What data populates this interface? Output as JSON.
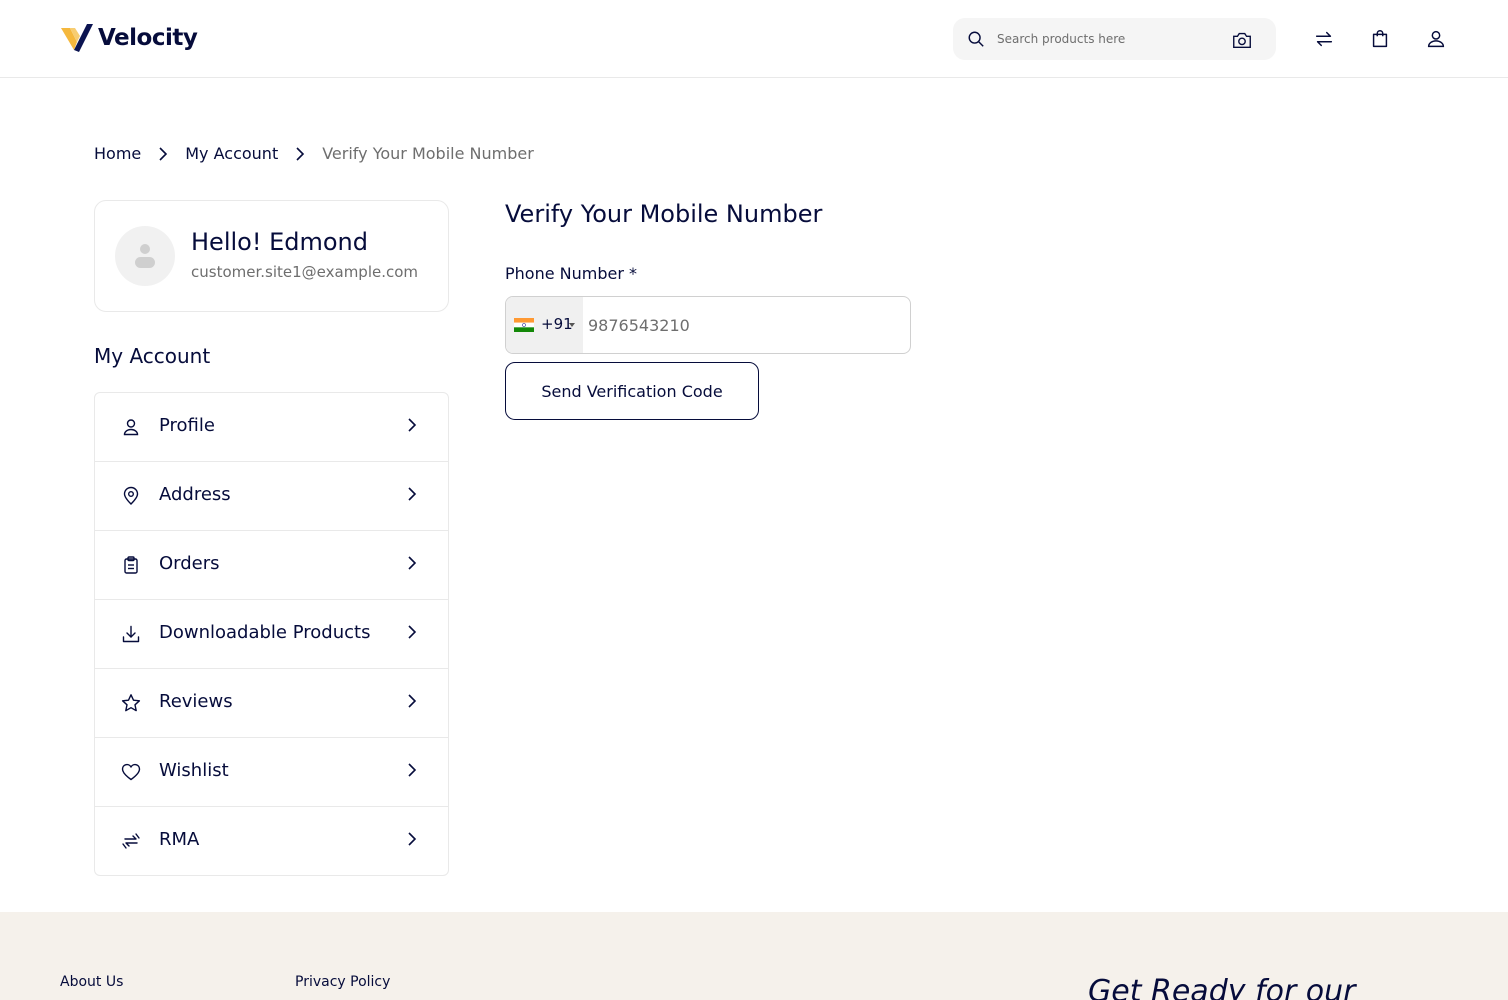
{
  "header": {
    "brand_name": "Velocity",
    "search_placeholder": "Search products here",
    "icons": [
      "search-icon",
      "camera-icon",
      "compare-icon",
      "cart-icon",
      "user-icon"
    ]
  },
  "breadcrumb": {
    "home": "Home",
    "account": "My Account",
    "current": "Verify Your Mobile Number"
  },
  "profile": {
    "greeting": "Hello! Edmond",
    "email": "customer.site1@example.com"
  },
  "sidebar": {
    "heading": "My Account",
    "items": [
      {
        "label": "Profile",
        "icon": "user-icon"
      },
      {
        "label": "Address",
        "icon": "location-pin-icon"
      },
      {
        "label": "Orders",
        "icon": "clipboard-icon"
      },
      {
        "label": "Downloadable Products",
        "icon": "download-icon"
      },
      {
        "label": "Reviews",
        "icon": "star-icon"
      },
      {
        "label": "Wishlist",
        "icon": "heart-icon"
      },
      {
        "label": "RMA",
        "icon": "return-icon"
      }
    ]
  },
  "main": {
    "title": "Verify Your Mobile Number",
    "phone_label": "Phone Number *",
    "country_code": "+91",
    "phone_value": "9876543210",
    "send_button": "Send Verification Code"
  },
  "footer": {
    "links": [
      "About Us",
      "Privacy Policy"
    ],
    "promo": "Get Ready for our"
  },
  "colors": {
    "primary": "#060c3b",
    "muted": "#6e6e6e",
    "border": "#e9e9e9",
    "footer_bg": "#f5f1eb",
    "logo_gold": "#f5b83d"
  }
}
